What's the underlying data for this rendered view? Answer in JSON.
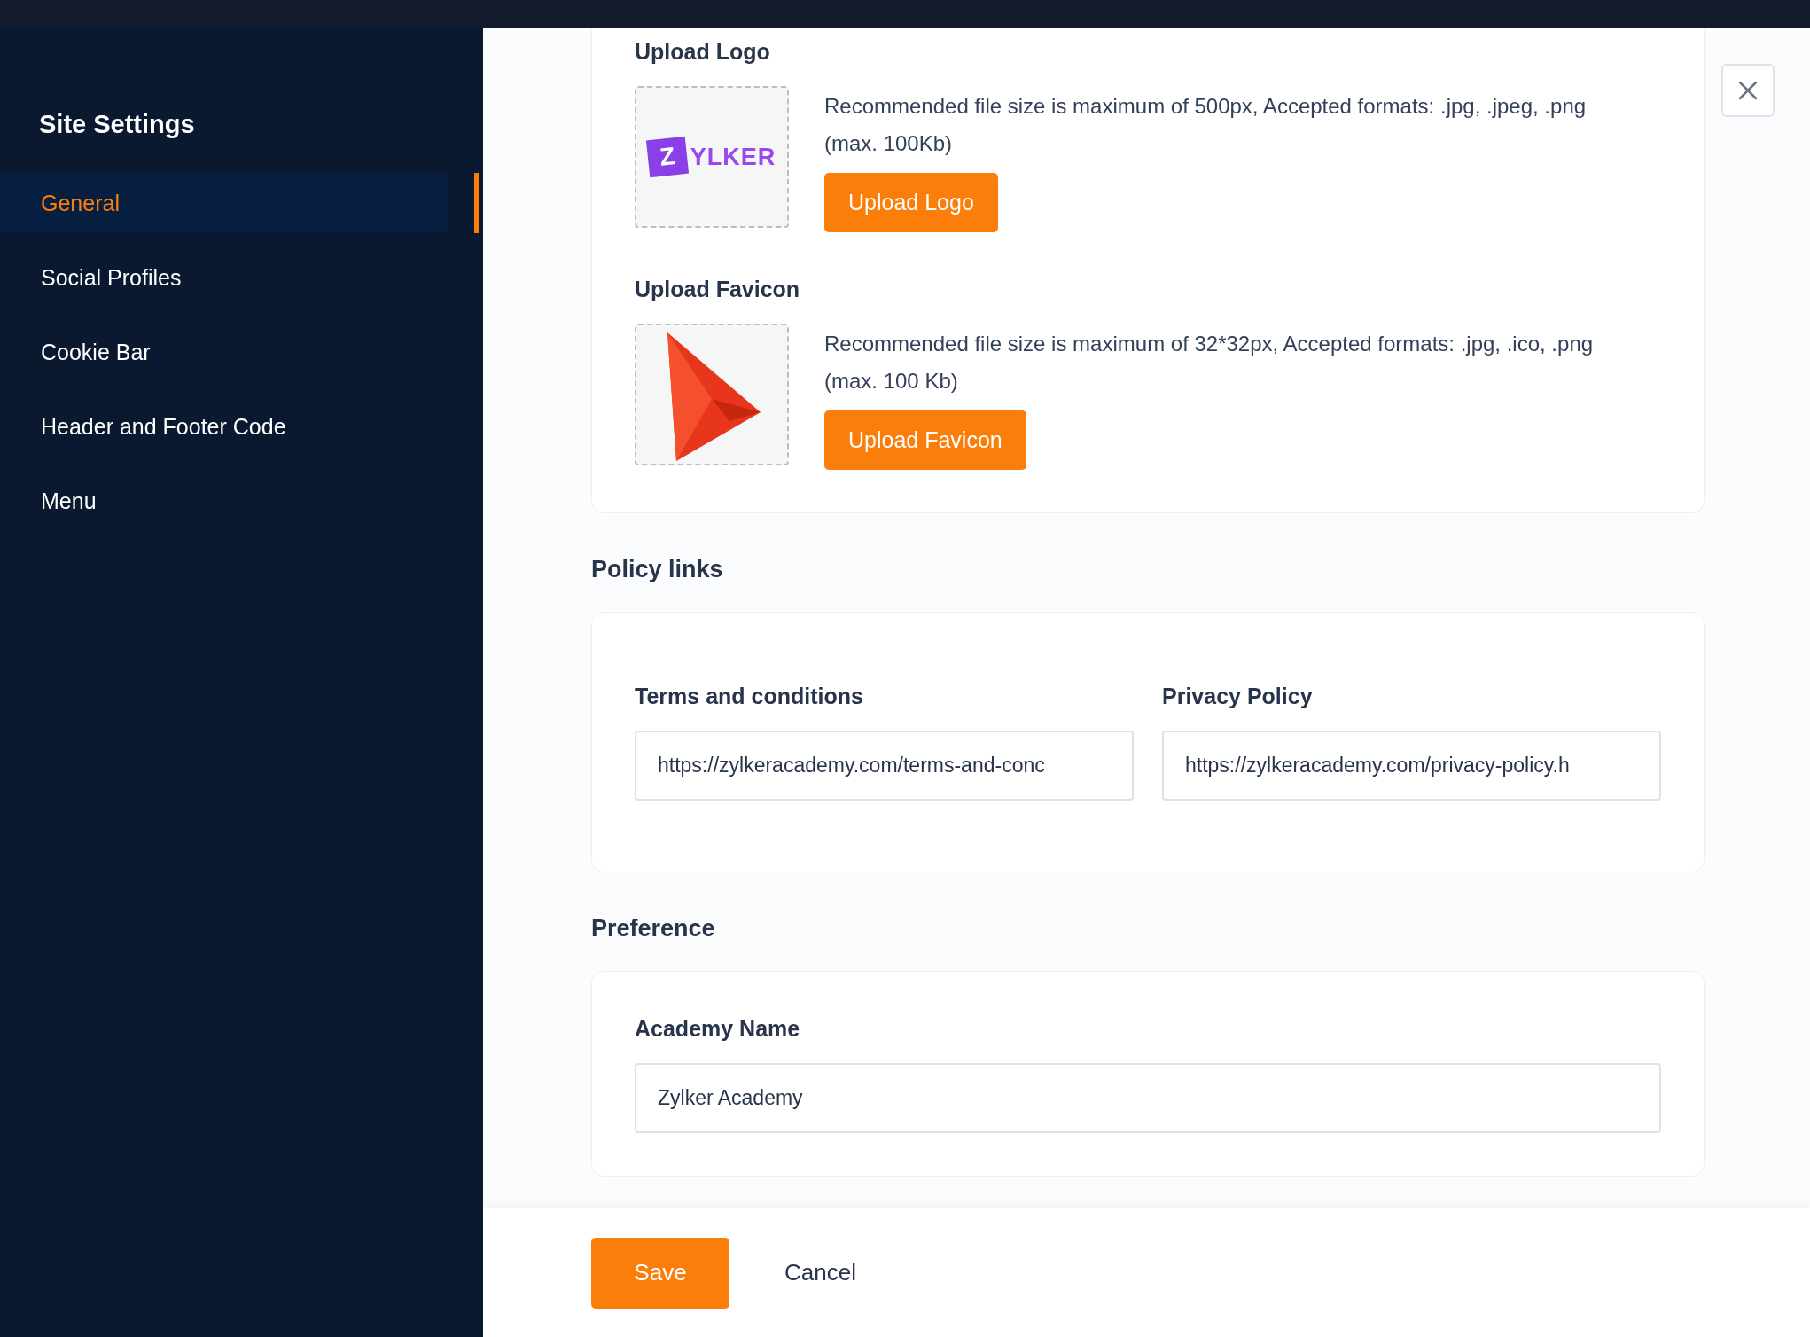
{
  "sidebar": {
    "title": "Site Settings",
    "items": [
      {
        "label": "General",
        "selected": true
      },
      {
        "label": "Social Profiles",
        "selected": false
      },
      {
        "label": "Cookie Bar",
        "selected": false
      },
      {
        "label": "Header and Footer Code",
        "selected": false
      },
      {
        "label": "Menu",
        "selected": false
      }
    ]
  },
  "uploads": [
    {
      "kind": "logo",
      "label": "Upload Logo",
      "logo_mark": "Z",
      "logo_word": "YLKER",
      "hint": "Recommended file size is maximum of 500px, Accepted formats: .jpg, .jpeg, .png (max. 100Kb)",
      "button": "Upload Logo"
    },
    {
      "kind": "favicon",
      "label": "Upload Favicon",
      "hint": "Recommended file size is maximum of 32*32px, Accepted formats: .jpg, .ico, .png (max. 100 Kb)",
      "button": "Upload Favicon"
    }
  ],
  "policy_links": {
    "title": "Policy links",
    "fields": [
      {
        "label": "Terms and conditions",
        "value": "https://zylkeracademy.com/terms-and-conc"
      },
      {
        "label": "Privacy Policy",
        "value": "https://zylkeracademy.com/privacy-policy.h"
      }
    ]
  },
  "preference": {
    "title": "Preference",
    "fields": [
      {
        "label": "Academy Name",
        "value": "Zylker Academy"
      }
    ]
  },
  "footer": {
    "save": "Save",
    "cancel": "Cancel"
  }
}
